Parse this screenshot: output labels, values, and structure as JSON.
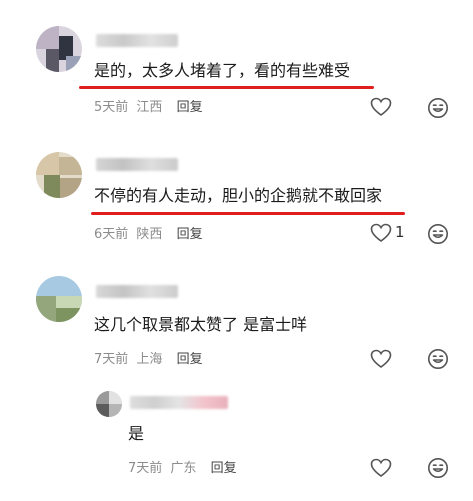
{
  "comments": [
    {
      "text": "是的，太多人堵着了，看的有些难受",
      "time": "5天前",
      "location": "江西",
      "reply_label": "回复",
      "likes": ""
    },
    {
      "text": "不停的有人走动，胆小的企鹅就不敢回家",
      "time": "6天前",
      "location": "陕西",
      "reply_label": "回复",
      "likes": "1"
    },
    {
      "text": "这几个取景都太赞了 是富士咩",
      "time": "7天前",
      "location": "上海",
      "reply_label": "回复",
      "likes": ""
    },
    {
      "text": "是",
      "time": "7天前",
      "location": "广东",
      "reply_label": "回复",
      "likes": ""
    }
  ],
  "colors": {
    "highlight_underline": "#e01e1e",
    "meta_text": "#8c8c8c",
    "body_text": "#1b1b1b"
  },
  "icons": [
    "heart-icon",
    "emoji-icon"
  ]
}
